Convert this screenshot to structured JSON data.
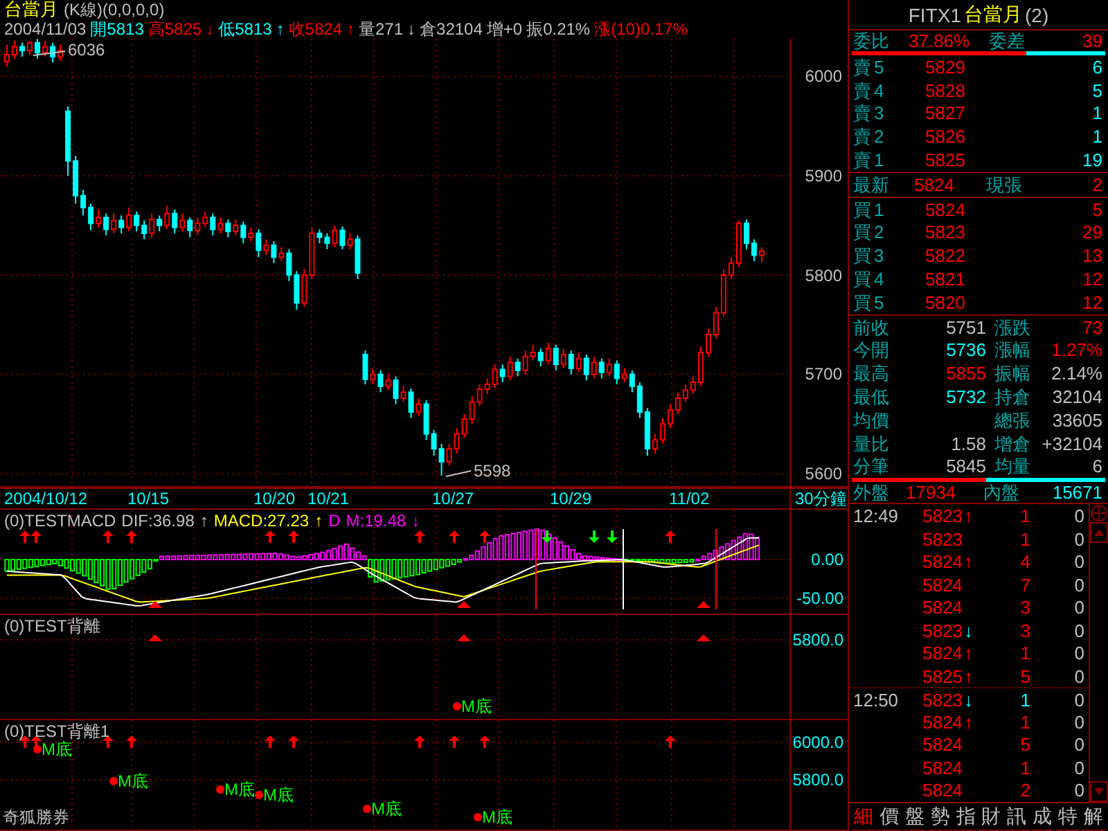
{
  "chart_header": {
    "title": "台當月",
    "mode": "(K線)(0,0,0,0)",
    "quote": [
      {
        "text": "2004/11/03",
        "rise": false,
        "fall": false
      },
      {
        "text": "開5813",
        "rise": false,
        "fall": true
      },
      {
        "text": "高5825",
        "rise": true,
        "fall": false
      },
      {
        "text": "↓",
        "rise": true,
        "fall": false
      },
      {
        "text": "低5813",
        "rise": false,
        "fall": true
      },
      {
        "text": "↑",
        "rise": false,
        "fall": true
      },
      {
        "text": "收5824",
        "rise": true,
        "fall": false
      },
      {
        "text": "↑",
        "rise": true,
        "fall": false
      },
      {
        "text": "量271",
        "rise": false,
        "fall": false
      },
      {
        "text": "↓",
        "rise": false,
        "fall": false
      },
      {
        "text": "倉32104",
        "rise": false,
        "fall": false
      },
      {
        "text": "增+0",
        "rise": false,
        "fall": false
      },
      {
        "text": "振0.21%",
        "rise": false,
        "fall": false
      },
      {
        "text": "漲(10)0.17%",
        "rise": true,
        "fall": false
      }
    ]
  },
  "price_chart": {
    "high_label": "6036",
    "low_label": "5598",
    "chart_data": {
      "type": "candlestick",
      "ylim": [
        5586,
        6038
      ],
      "yticks": [
        6000,
        5900,
        5800,
        5700,
        5600
      ],
      "grid": true,
      "ohlc": [
        [
          6015,
          6032,
          6010,
          6022
        ],
        [
          6022,
          6036,
          6018,
          6030
        ],
        [
          6030,
          6034,
          6020,
          6026
        ],
        [
          6026,
          6036,
          6022,
          6034
        ],
        [
          6034,
          6038,
          6018,
          6024
        ],
        [
          6024,
          6036,
          6020,
          6030
        ],
        [
          6030,
          6034,
          6014,
          6020
        ],
        [
          6020,
          6032,
          6016,
          6026
        ],
        [
          5965,
          5970,
          5900,
          5915
        ],
        [
          5915,
          5920,
          5872,
          5880
        ],
        [
          5880,
          5886,
          5860,
          5868
        ],
        [
          5868,
          5872,
          5845,
          5852
        ],
        [
          5852,
          5866,
          5848,
          5858
        ],
        [
          5858,
          5862,
          5840,
          5846
        ],
        [
          5846,
          5862,
          5842,
          5855
        ],
        [
          5855,
          5860,
          5842,
          5848
        ],
        [
          5848,
          5868,
          5844,
          5860
        ],
        [
          5860,
          5864,
          5844,
          5850
        ],
        [
          5850,
          5855,
          5836,
          5842
        ],
        [
          5842,
          5862,
          5838,
          5856
        ],
        [
          5856,
          5860,
          5844,
          5850
        ],
        [
          5850,
          5870,
          5846,
          5862
        ],
        [
          5862,
          5866,
          5842,
          5848
        ],
        [
          5848,
          5862,
          5844,
          5855
        ],
        [
          5855,
          5858,
          5838,
          5845
        ],
        [
          5845,
          5858,
          5840,
          5852
        ],
        [
          5852,
          5864,
          5848,
          5858
        ],
        [
          5858,
          5862,
          5840,
          5846
        ],
        [
          5846,
          5858,
          5842,
          5852
        ],
        [
          5852,
          5856,
          5838,
          5844
        ],
        [
          5844,
          5856,
          5840,
          5850
        ],
        [
          5850,
          5854,
          5832,
          5838
        ],
        [
          5838,
          5848,
          5834,
          5842
        ],
        [
          5842,
          5846,
          5818,
          5825
        ],
        [
          5825,
          5836,
          5820,
          5830
        ],
        [
          5830,
          5834,
          5812,
          5818
        ],
        [
          5818,
          5828,
          5814,
          5822
        ],
        [
          5822,
          5826,
          5794,
          5800
        ],
        [
          5800,
          5804,
          5765,
          5772
        ],
        [
          5772,
          5806,
          5768,
          5800
        ],
        [
          5800,
          5848,
          5796,
          5842
        ],
        [
          5842,
          5846,
          5832,
          5838
        ],
        [
          5838,
          5842,
          5826,
          5832
        ],
        [
          5832,
          5850,
          5828,
          5845
        ],
        [
          5845,
          5849,
          5826,
          5830
        ],
        [
          5830,
          5842,
          5826,
          5836
        ],
        [
          5836,
          5840,
          5796,
          5802
        ],
        [
          5720,
          5724,
          5690,
          5695
        ],
        [
          5695,
          5706,
          5690,
          5700
        ],
        [
          5700,
          5704,
          5682,
          5688
        ],
        [
          5688,
          5700,
          5684,
          5694
        ],
        [
          5694,
          5698,
          5670,
          5676
        ],
        [
          5676,
          5688,
          5672,
          5682
        ],
        [
          5682,
          5686,
          5656,
          5662
        ],
        [
          5662,
          5676,
          5658,
          5670
        ],
        [
          5670,
          5674,
          5634,
          5640
        ],
        [
          5640,
          5644,
          5618,
          5625
        ],
        [
          5625,
          5630,
          5598,
          5612
        ],
        [
          5612,
          5630,
          5608,
          5625
        ],
        [
          5625,
          5646,
          5620,
          5640
        ],
        [
          5640,
          5660,
          5636,
          5655
        ],
        [
          5655,
          5678,
          5650,
          5672
        ],
        [
          5672,
          5690,
          5668,
          5685
        ],
        [
          5685,
          5696,
          5680,
          5690
        ],
        [
          5690,
          5710,
          5686,
          5705
        ],
        [
          5705,
          5710,
          5692,
          5698
        ],
        [
          5698,
          5718,
          5694,
          5712
        ],
        [
          5712,
          5716,
          5698,
          5704
        ],
        [
          5704,
          5724,
          5700,
          5718
        ],
        [
          5718,
          5730,
          5714,
          5722
        ],
        [
          5722,
          5726,
          5708,
          5714
        ],
        [
          5714,
          5732,
          5710,
          5726
        ],
        [
          5726,
          5730,
          5704,
          5710
        ],
        [
          5710,
          5726,
          5706,
          5720
        ],
        [
          5720,
          5724,
          5700,
          5706
        ],
        [
          5706,
          5722,
          5702,
          5716
        ],
        [
          5716,
          5720,
          5694,
          5700
        ],
        [
          5700,
          5718,
          5696,
          5712
        ],
        [
          5712,
          5716,
          5696,
          5702
        ],
        [
          5702,
          5716,
          5698,
          5710
        ],
        [
          5710,
          5714,
          5690,
          5696
        ],
        [
          5696,
          5706,
          5692,
          5700
        ],
        [
          5700,
          5704,
          5682,
          5688
        ],
        [
          5688,
          5692,
          5656,
          5662
        ],
        [
          5662,
          5666,
          5618,
          5625
        ],
        [
          5625,
          5640,
          5620,
          5634
        ],
        [
          5634,
          5656,
          5630,
          5650
        ],
        [
          5650,
          5670,
          5646,
          5664
        ],
        [
          5664,
          5682,
          5660,
          5676
        ],
        [
          5676,
          5690,
          5672,
          5684
        ],
        [
          5684,
          5698,
          5680,
          5692
        ],
        [
          5692,
          5728,
          5688,
          5722
        ],
        [
          5722,
          5746,
          5718,
          5740
        ],
        [
          5740,
          5768,
          5736,
          5762
        ],
        [
          5762,
          5806,
          5758,
          5800
        ],
        [
          5800,
          5818,
          5796,
          5812
        ],
        [
          5812,
          5855,
          5808,
          5852
        ],
        [
          5852,
          5856,
          5826,
          5832
        ],
        [
          5832,
          5836,
          5814,
          5820
        ],
        [
          5820,
          5828,
          5813,
          5824
        ]
      ]
    }
  },
  "date_axis": {
    "dates": [
      "2004/10/12",
      "10/15",
      "10/20",
      "10/21",
      "10/27",
      "10/29",
      "11/02"
    ],
    "period": "30分鐘"
  },
  "macd": {
    "legend": [
      {
        "text": "(0)TESTMACD",
        "kind": "name"
      },
      {
        "text": "DIF:36.98",
        "kind": "dif"
      },
      {
        "text": "↑",
        "kind": "dif"
      },
      {
        "text": "MACD:27.23",
        "kind": "macd"
      },
      {
        "text": "↑",
        "kind": "macd"
      },
      {
        "text": "D",
        "kind": "m"
      },
      {
        "text": "M:19.48",
        "kind": "m"
      },
      {
        "text": "↓",
        "kind": "m"
      }
    ],
    "axis": [
      "0.00",
      "-50.00"
    ]
  },
  "divergence": {
    "title": "(0)TEST背離",
    "axis": [
      "5800.0"
    ],
    "markers": [
      "M底"
    ]
  },
  "divergence_1": {
    "title": "(0)TEST背離1",
    "axis": [
      "6000.0",
      "5800.0"
    ],
    "markers": [
      "M底",
      "M底",
      "M底",
      "M底",
      "M底",
      "M底"
    ]
  },
  "footer_brand": "奇狐勝券",
  "quote_panel": {
    "symbol": "FITX1",
    "name": "台當月",
    "suffix": "(2)",
    "bid_ask": {
      "label": "委比",
      "value": "37.86%",
      "diff_label": "委差",
      "diff": "39",
      "level": 0.69
    },
    "asks": [
      {
        "label": "賣5",
        "price": "5829",
        "volume": "6"
      },
      {
        "label": "賣4",
        "price": "5828",
        "volume": "5"
      },
      {
        "label": "賣3",
        "price": "5827",
        "volume": "1"
      },
      {
        "label": "賣2",
        "price": "5826",
        "volume": "1"
      },
      {
        "label": "賣1",
        "price": "5825",
        "volume": "19"
      }
    ],
    "last": {
      "label": "最新",
      "price": "5824",
      "label2": "現張",
      "volume": "2"
    },
    "bids": [
      {
        "label": "買1",
        "price": "5824",
        "volume": "5"
      },
      {
        "label": "買2",
        "price": "5823",
        "volume": "29"
      },
      {
        "label": "買3",
        "price": "5822",
        "volume": "13"
      },
      {
        "label": "買4",
        "price": "5821",
        "volume": "12"
      },
      {
        "label": "買5",
        "price": "5820",
        "volume": "12"
      }
    ],
    "stats": [
      {
        "label": "前收",
        "value": "5751",
        "rise": false,
        "fall": false,
        "label2": "漲跌",
        "value2": "73",
        "rise2": true,
        "fall2": false
      },
      {
        "label": "今開",
        "value": "5736",
        "rise": false,
        "fall": true,
        "label2": "漲幅",
        "value2": "1.27%",
        "rise2": true,
        "fall2": false
      },
      {
        "label": "最高",
        "value": "5855",
        "rise": true,
        "fall": false,
        "label2": "振幅",
        "value2": "2.14%",
        "rise2": false,
        "fall2": false
      },
      {
        "label": "最低",
        "value": "5732",
        "rise": false,
        "fall": true,
        "label2": "持倉",
        "value2": "32104",
        "rise2": false,
        "fall2": false
      },
      {
        "label": "均價",
        "label2": "總張",
        "value2": "33605",
        "rise2": false,
        "fall2": false
      },
      {
        "label": "量比",
        "value": "1.58",
        "rise": false,
        "fall": false,
        "label2": "增倉",
        "value2": "+32104",
        "rise2": false,
        "fall2": false
      },
      {
        "label": "分筆",
        "value": "5845",
        "rise": false,
        "fall": false,
        "label2": "均量",
        "value2": "6",
        "rise2": false,
        "fall2": false
      }
    ],
    "outer_inner": {
      "outer_label": "外盤",
      "outer": "17934",
      "inner_label": "內盤",
      "inner": "15671",
      "level": 0.53
    }
  },
  "ticks": [
    {
      "time": "12:49",
      "price": "5823",
      "arrow": "↑",
      "rising": true,
      "volume": "1",
      "volume_rising": true,
      "extra": "0"
    },
    {
      "price": "5823",
      "volume": "1",
      "volume_rising": true,
      "extra": "0"
    },
    {
      "price": "5824",
      "arrow": "↑",
      "rising": true,
      "volume": "4",
      "volume_rising": true,
      "extra": "0"
    },
    {
      "price": "5824",
      "volume": "7",
      "volume_rising": true,
      "extra": "0"
    },
    {
      "price": "5824",
      "volume": "3",
      "volume_rising": true,
      "extra": "0"
    },
    {
      "price": "5823",
      "arrow": "↓",
      "rising": false,
      "volume": "3",
      "volume_rising": true,
      "extra": "0"
    },
    {
      "price": "5824",
      "arrow": "↑",
      "rising": true,
      "volume": "1",
      "volume_rising": true,
      "extra": "0"
    },
    {
      "price": "5825",
      "arrow": "↑",
      "rising": true,
      "volume": "5",
      "volume_rising": true,
      "extra": "0"
    },
    {
      "time": "12:50",
      "price": "5823",
      "arrow": "↓",
      "rising": false,
      "volume": "1",
      "volume_rising": false,
      "extra": "0"
    },
    {
      "price": "5824",
      "arrow": "↑",
      "rising": true,
      "volume": "1",
      "volume_rising": true,
      "extra": "0"
    },
    {
      "price": "5824",
      "volume": "5",
      "volume_rising": true,
      "extra": "0"
    },
    {
      "price": "5824",
      "volume": "1",
      "volume_rising": true,
      "extra": "0"
    },
    {
      "price": "5824",
      "volume": "2",
      "volume_rising": true,
      "extra": "0"
    }
  ],
  "tabs": [
    {
      "label": "細",
      "selected": true
    },
    {
      "label": "價",
      "selected": false
    },
    {
      "label": "盤",
      "selected": false
    },
    {
      "label": "勢",
      "selected": false
    },
    {
      "label": "指",
      "selected": false
    },
    {
      "label": "財",
      "selected": false
    },
    {
      "label": "訊",
      "selected": false
    },
    {
      "label": "成",
      "selected": false
    },
    {
      "label": "特",
      "selected": false
    },
    {
      "label": "解",
      "selected": false
    }
  ]
}
